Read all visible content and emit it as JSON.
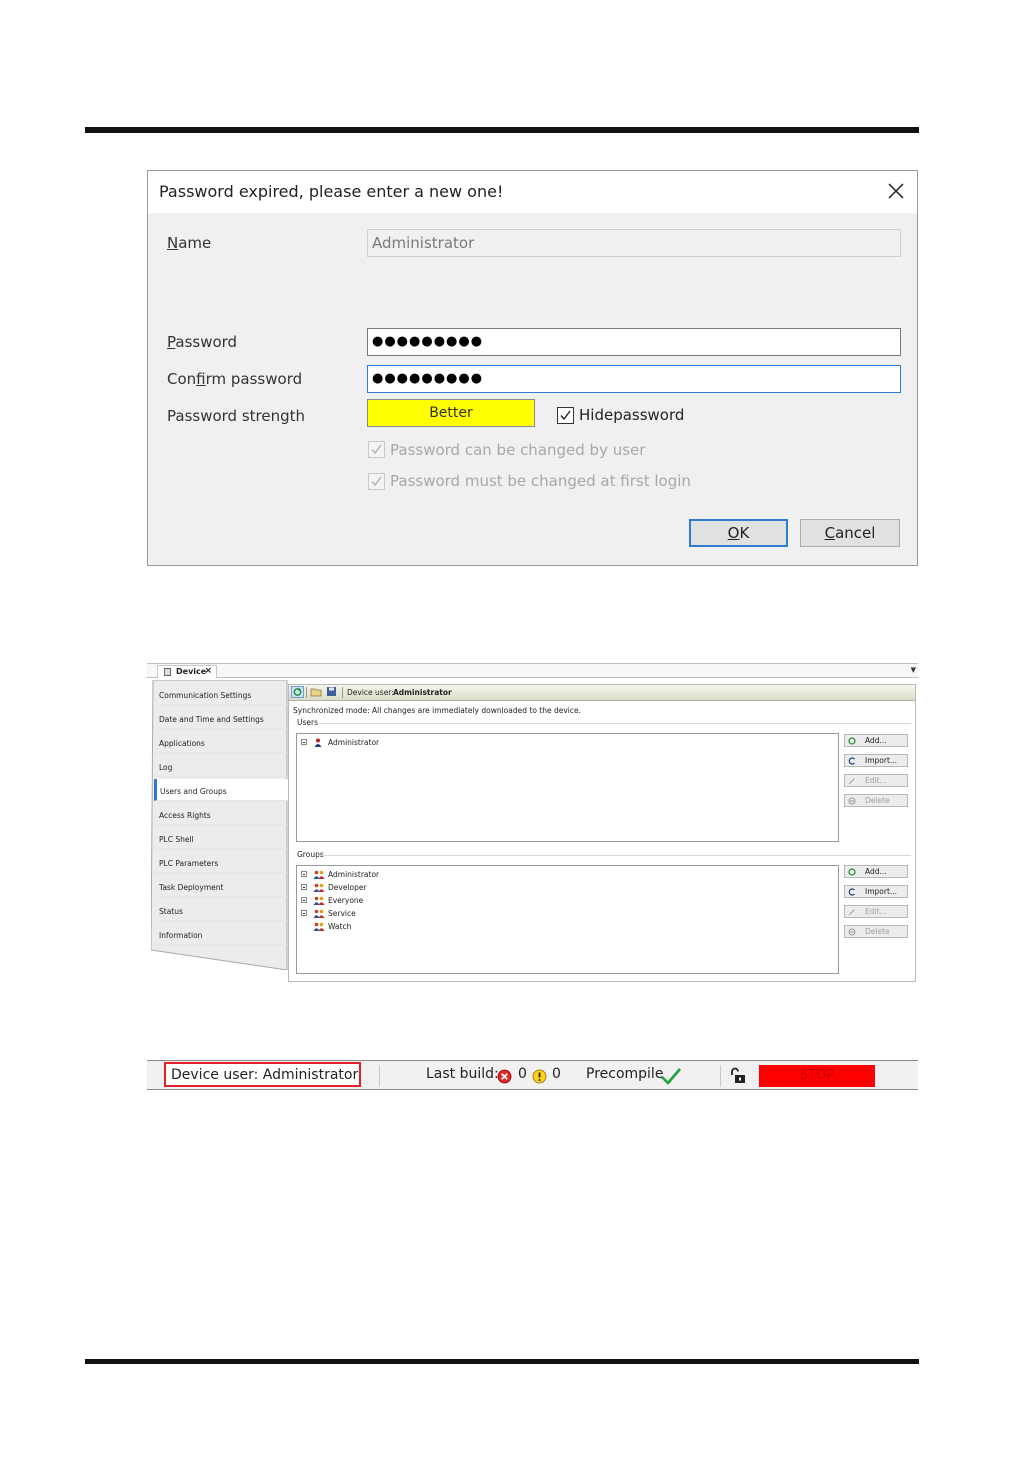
{
  "dialog": {
    "title": "Password expired, please enter a new one!",
    "name_label_u": "N",
    "name_label_rest": "ame",
    "name_value": "Administrator",
    "password_label_u": "P",
    "password_label_rest": "assword",
    "password_value": "●●●●●●●●●",
    "confirm_label_a": "Con",
    "confirm_label_u": "f",
    "confirm_label_b": "irm password",
    "confirm_value": "●●●●●●●●●",
    "strength_label": "Password strength",
    "strength_value": "Better",
    "strength_color": "#ffff00",
    "hide_password_label": "Hidepassword",
    "hide_password_checked": true,
    "can_change_label": "Password can be changed by user",
    "must_change_label": "Password must be changed at first login",
    "ok_u": "O",
    "ok_rest": "K",
    "cancel_u": "C",
    "cancel_rest": "ancel"
  },
  "editor": {
    "tab_label": "Device",
    "nav_items": [
      "Communication Settings",
      "Date and Time and Settings",
      "Applications",
      "Log",
      "Users and Groups",
      "Access Rights",
      "PLC Shell",
      "PLC Parameters",
      "Task Deployment",
      "Status",
      "Information"
    ],
    "active_nav": "Users and Groups",
    "device_user_label": "Device user:",
    "device_user_value": "Administrator",
    "sync_text": "Synchronized mode: All changes are immediately downloaded to the device.",
    "users_label": "Users",
    "users": [
      "Administrator"
    ],
    "groups_label": "Groups",
    "groups": [
      "Administrator",
      "Developer",
      "Everyone",
      "Service",
      "Watch"
    ],
    "buttons": {
      "add": "Add...",
      "import": "Import...",
      "edit": "Edit...",
      "delete": "Delete"
    }
  },
  "statusbar": {
    "device_user": "Device user: Administrator",
    "last_build_label": "Last build:",
    "errors": "0",
    "warnings": "0",
    "precompile_label": "Precompile",
    "stop_label": "STOP",
    "stop_color": "#ff0000"
  }
}
